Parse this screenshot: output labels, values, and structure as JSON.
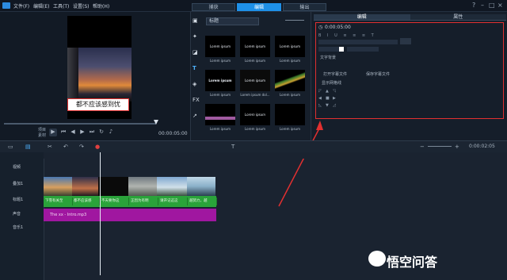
{
  "menu": [
    "文件(F)",
    "编辑(E)",
    "工具(T)",
    "设置(S)",
    "帮助(H)"
  ],
  "tabs": [
    {
      "label": "捕获"
    },
    {
      "label": "编辑"
    },
    {
      "label": "输出"
    }
  ],
  "window_controls": [
    "?",
    "–",
    "□",
    "×"
  ],
  "preview": {
    "subtitle": "都不应该感到忧",
    "timecode": "00:00:05:00",
    "mode_labels": [
      "项目",
      "素材"
    ]
  },
  "library": {
    "category": "标题",
    "icons": [
      "media-icon",
      "instant-project-icon",
      "transition-icon",
      "title-icon",
      "graphic-icon",
      "fx-icon",
      "path-icon"
    ],
    "thumbnails": [
      {
        "text": "Lorem ipsum",
        "label": "Lorem ipsum"
      },
      {
        "text": "Lorem ipsum",
        "label": "Lorem ipsum"
      },
      {
        "text": "Lorem ipsum",
        "label": "Lorem ipsum"
      },
      {
        "text": "Lorem ipsum",
        "label": "Lorem ipsum"
      },
      {
        "text": "Lorem ipsum",
        "label": "Lorem ipsum dol..."
      },
      {
        "text": "",
        "label": "Lorem ipsum"
      },
      {
        "text": "",
        "label": "Lorem ipsum"
      },
      {
        "text": "Lorem ipsum",
        "label": "Lorem ipsum"
      },
      {
        "text": "",
        "label": "Lorem ipsum"
      }
    ]
  },
  "options": {
    "tabs": [
      {
        "label": "编辑"
      },
      {
        "label": "属性"
      }
    ],
    "duration": "0:00:05:00",
    "rows": [
      "文字背景",
      "打开字幕文件",
      "保存字幕文件",
      "显示网格线"
    ]
  },
  "timeline": {
    "timecode": "0:00:02:05",
    "tracks": [
      {
        "label": "视频"
      },
      {
        "label": "叠加1"
      },
      {
        "label": "标题1"
      },
      {
        "label": "声音"
      },
      {
        "label": "音乐1"
      }
    ],
    "title_clips": [
      "下雪有关至",
      "都不应该感",
      "不天要你这",
      "正因为有明",
      "请开记这这",
      "越努力，越"
    ],
    "music_clip": "The xx - Intro.mp3"
  },
  "watermark": "悟空问答",
  "colors": {
    "accent": "#1e90e8",
    "highlight": "#e23030",
    "title_track": "#2aa33a",
    "music_track": "#a017a0"
  }
}
